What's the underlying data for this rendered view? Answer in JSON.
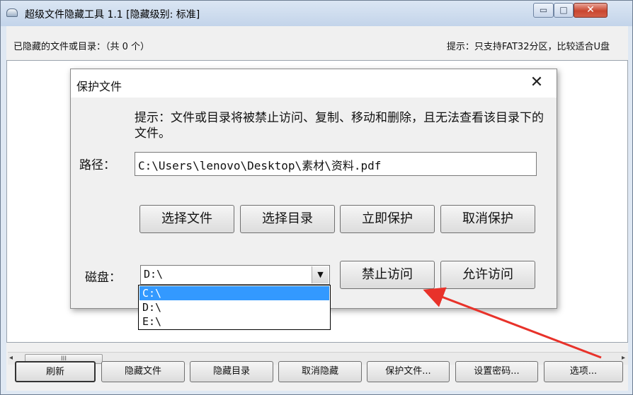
{
  "window": {
    "title": "超级文件隐藏工具 1.1 [隐藏级别: 标准]",
    "min_glyph": "▭",
    "max_glyph": "□",
    "close_glyph": "✕"
  },
  "main": {
    "hidden_label": "已隐藏的文件或目录：（共 0 个）",
    "hint": "提示：只支持FAT32分区，比较适合U盘",
    "scroll_grip": "III",
    "scroll_left": "◂",
    "scroll_right": "▸"
  },
  "toolbar": {
    "refresh": "刷新",
    "hide_file": "隐藏文件",
    "hide_dir": "隐藏目录",
    "unhide": "取消隐藏",
    "protect_file": "保护文件...",
    "set_password": "设置密码...",
    "options": "选项..."
  },
  "dialog": {
    "title": "保护文件",
    "close_glyph": "✕",
    "hint": "提示：文件或目录将被禁止访问、复制、移动和删除，且无法查看该目录下的文件。",
    "path_label": "路径：",
    "path_value": "C:\\Users\\lenovo\\Desktop\\素材\\资料.pdf",
    "buttons": {
      "choose_file": "选择文件",
      "choose_dir": "选择目录",
      "protect_now": "立即保护",
      "cancel_protect": "取消保护",
      "deny_access": "禁止访问",
      "allow_access": "允许访问"
    },
    "disk_label": "磁盘：",
    "disk_value": "D:\\",
    "disk_options": [
      "C:\\",
      "D:\\",
      "E:\\"
    ],
    "disk_arrow": "▼"
  },
  "annotation": {
    "arrow_color": "#e8322a"
  }
}
